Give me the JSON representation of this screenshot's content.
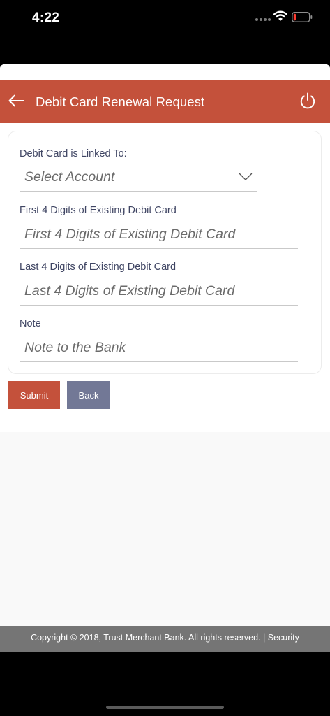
{
  "status_bar": {
    "time": "4:22"
  },
  "app_bar": {
    "title": "Debit Card Renewal Request"
  },
  "form": {
    "linked_account": {
      "label": "Debit Card is Linked To:",
      "value": "Select Account"
    },
    "first_digits": {
      "label": "First 4 Digits of Existing Debit Card",
      "placeholder": "First 4 Digits of Existing Debit Card"
    },
    "last_digits": {
      "label": "Last 4 Digits of Existing Debit Card",
      "placeholder": "Last 4 Digits of Existing Debit Card"
    },
    "note": {
      "label": "Note",
      "placeholder": "Note to the Bank"
    }
  },
  "actions": {
    "submit_label": "Submit",
    "back_label": "Back"
  },
  "footer": {
    "text": "Copyright © 2018, Trust Merchant Bank. All rights reserved. | Security"
  },
  "colors": {
    "primary": "#c4513b",
    "secondary_button": "#727896",
    "footer": "#757575"
  },
  "icons": {
    "back": "back-arrow-icon",
    "power": "power-icon",
    "dropdown": "chevron-down-icon",
    "wifi": "wifi-icon",
    "battery": "battery-icon",
    "signal": "signal-icon"
  }
}
